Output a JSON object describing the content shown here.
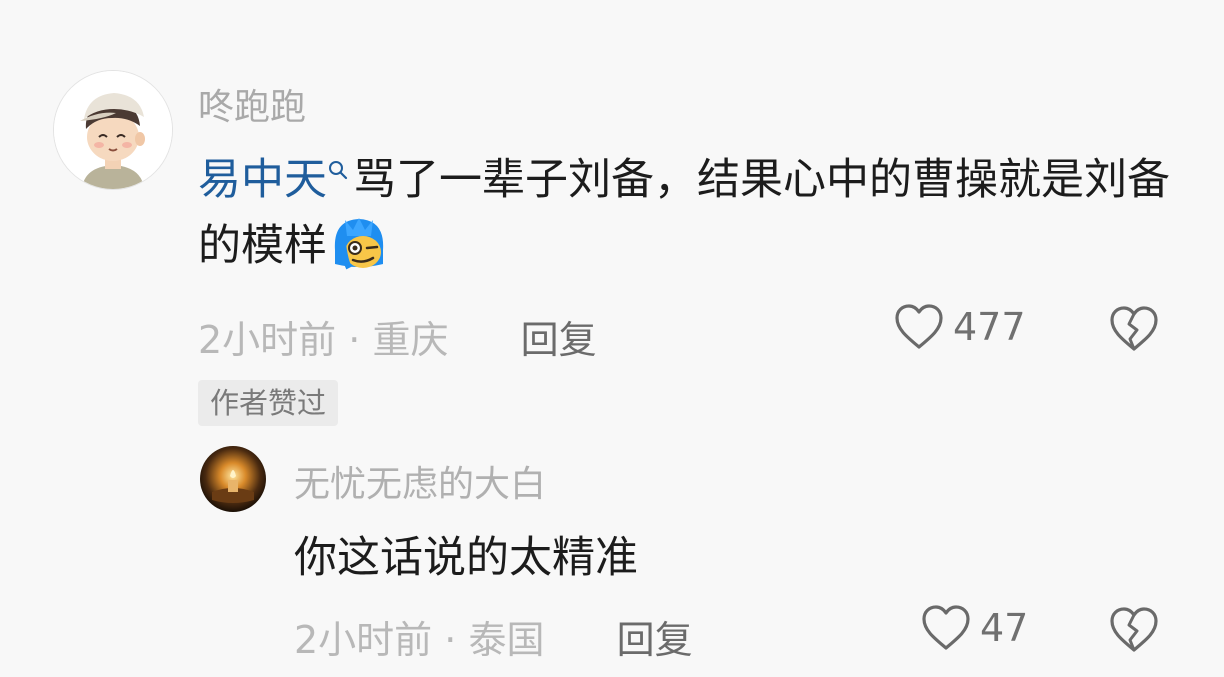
{
  "main_comment": {
    "username": "咚跑跑",
    "mention": "易中天",
    "text_part": "骂了一辈子刘备，结果心中的曹操就是刘备的模样",
    "emoji": "smug-face-emoji",
    "time": "2小时前",
    "separator": "·",
    "location": "重庆",
    "reply_label": "回复",
    "likes": "477",
    "author_liked_badge": "作者赞过"
  },
  "reply": {
    "username": "无忧无虑的大白",
    "text": "你这话说的太精准",
    "time": "2小时前",
    "separator": "·",
    "location": "泰国",
    "reply_label": "回复",
    "likes": "47"
  },
  "icons": {
    "like": "heart-outline-icon",
    "dislike": "broken-heart-icon",
    "search": "search-icon"
  },
  "colors": {
    "background": "#f8f8f8",
    "mention": "#1f5d9c",
    "text": "#1c1c1c",
    "muted": "#b8b8b8"
  }
}
